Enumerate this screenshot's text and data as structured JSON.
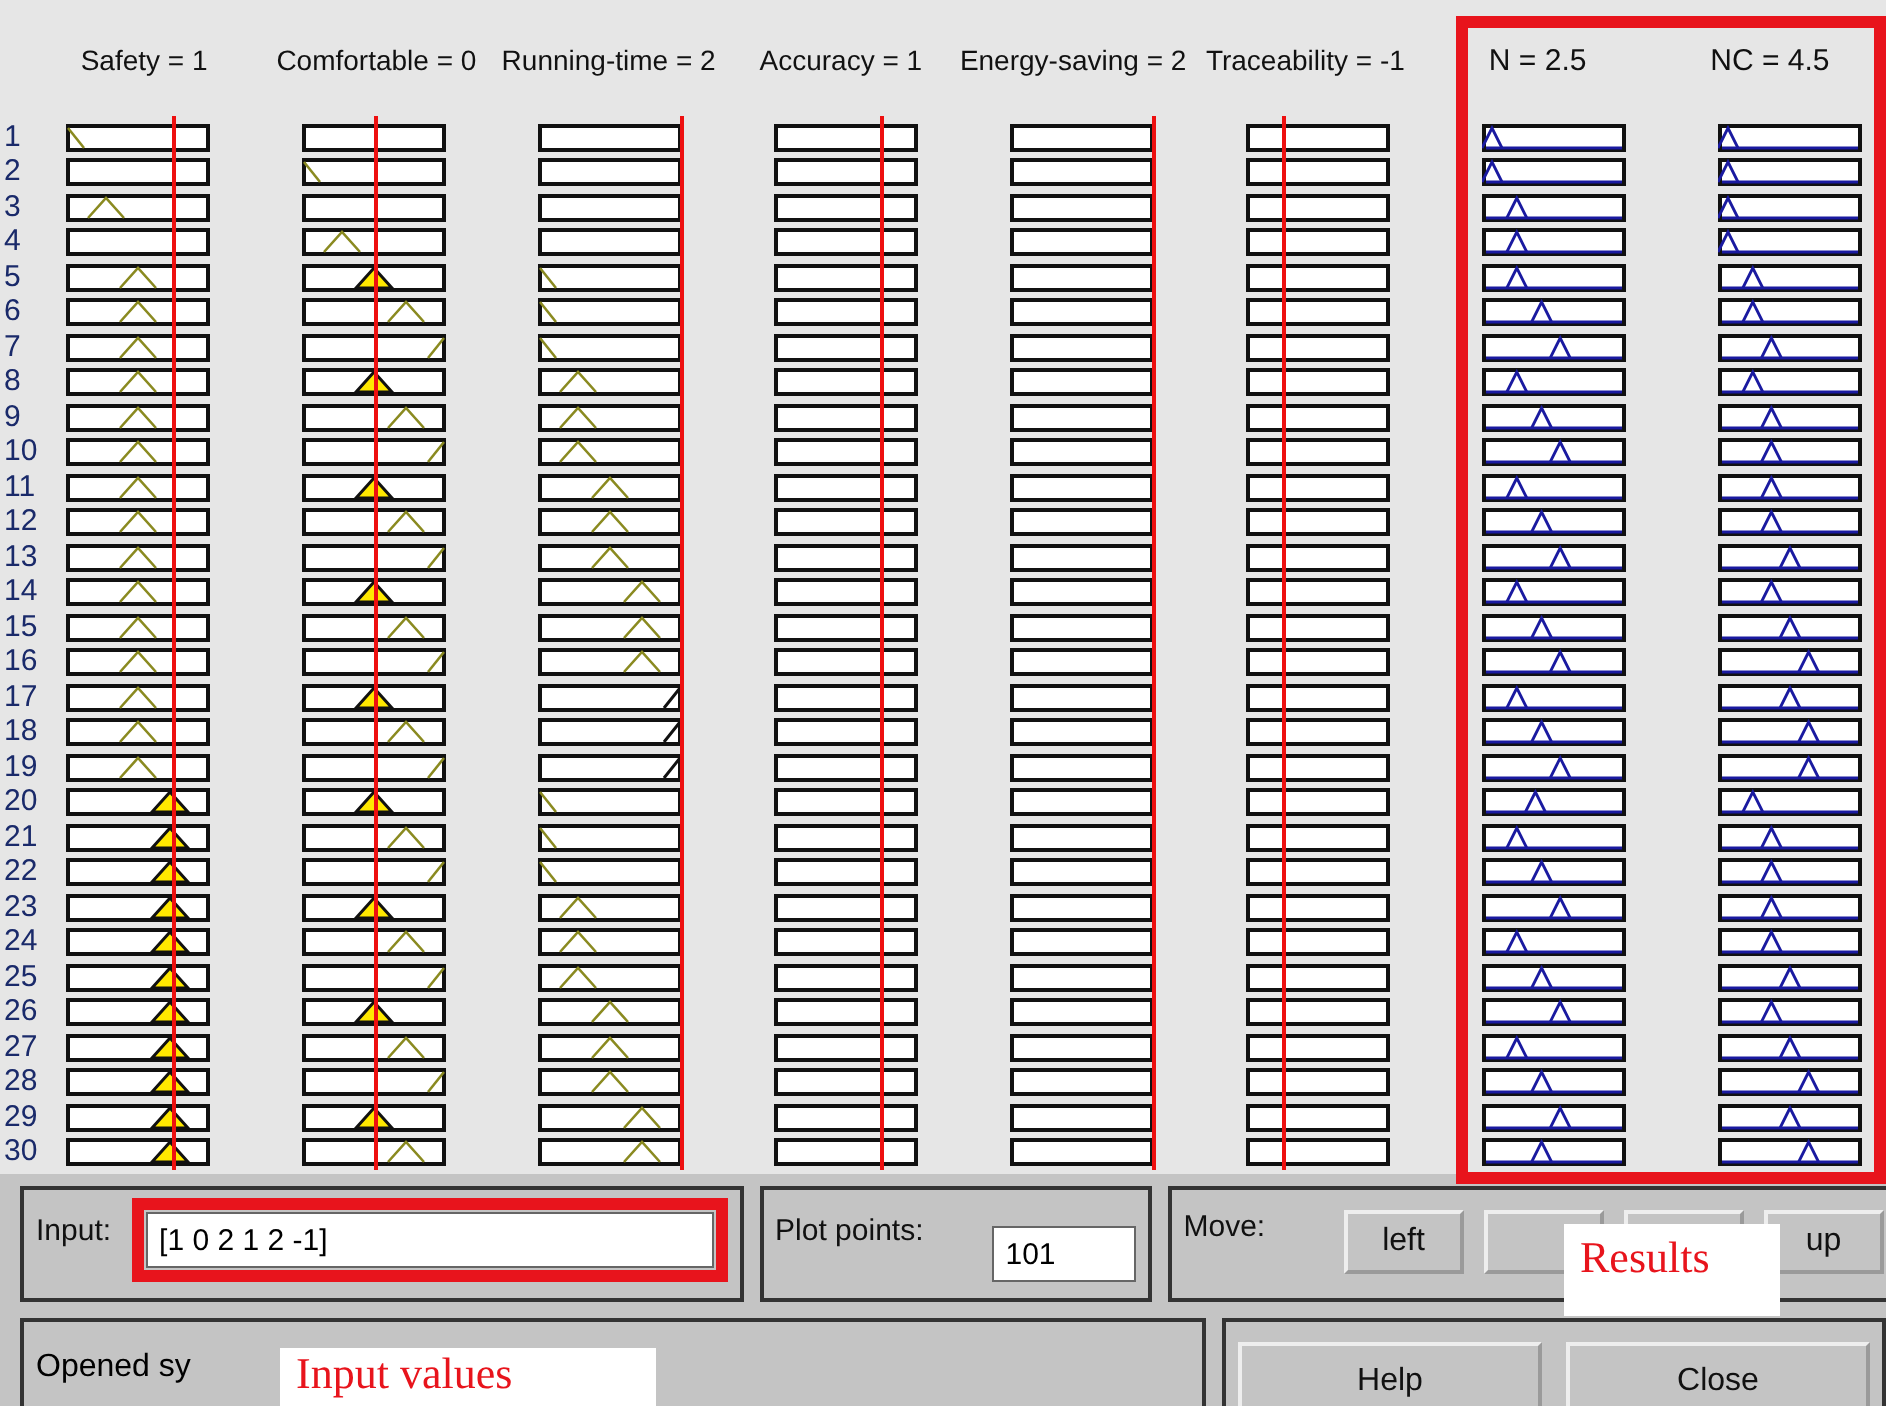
{
  "inputs": [
    {
      "label": "Safety = 1"
    },
    {
      "label": "Comfortable = 0"
    },
    {
      "label": "Running-time = 2"
    },
    {
      "label": "Accuracy = 1"
    },
    {
      "label": "Energy-saving = 2"
    },
    {
      "label": "Traceability = -1"
    }
  ],
  "outputs": [
    {
      "label": "N = 2.5"
    },
    {
      "label": "NC = 4.5"
    }
  ],
  "rules": [
    "1",
    "2",
    "3",
    "4",
    "5",
    "6",
    "7",
    "8",
    "9",
    "10",
    "11",
    "12",
    "13",
    "14",
    "15",
    "16",
    "17",
    "18",
    "19",
    "20",
    "21",
    "22",
    "23",
    "24",
    "25",
    "26",
    "27",
    "28",
    "29",
    "30"
  ],
  "input_field": {
    "label": "Input:",
    "value": "[1 0 2 1 2 -1]"
  },
  "plot_points": {
    "label": "Plot points:",
    "value": "101"
  },
  "move": {
    "label": "Move:",
    "buttons": [
      {
        "kind": "text",
        "label": "left"
      },
      {
        "kind": "covered"
      },
      {
        "kind": "covered"
      },
      {
        "kind": "text",
        "label": "up"
      }
    ]
  },
  "status": "Opened sy",
  "buttons": [
    "Help",
    "Close"
  ],
  "annotations": [
    {
      "kind": "input",
      "text": "Input values"
    },
    {
      "kind": "results",
      "text": "Results"
    }
  ]
}
